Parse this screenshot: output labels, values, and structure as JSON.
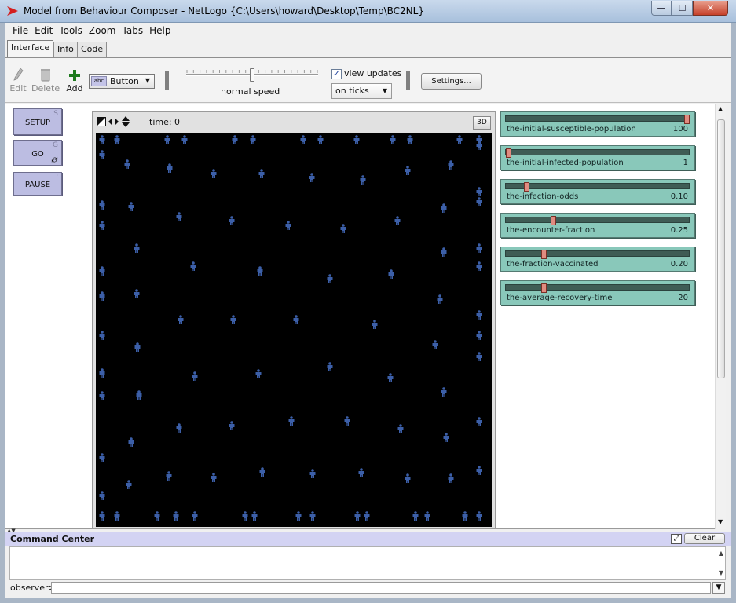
{
  "window": {
    "title": "Model from Behaviour Composer - NetLogo {C:\\Users\\howard\\Desktop\\Temp\\BC2NL}",
    "min_glyph": "—",
    "max_glyph": "☐",
    "close_glyph": "✕"
  },
  "menu": [
    "File",
    "Edit",
    "Tools",
    "Zoom",
    "Tabs",
    "Help"
  ],
  "tabs": [
    {
      "label": "Interface",
      "active": true
    },
    {
      "label": "Info",
      "active": false
    },
    {
      "label": "Code",
      "active": false
    }
  ],
  "toolbar": {
    "edit_label": "Edit",
    "delete_label": "Delete",
    "add_label": "Add",
    "widget_type_icon_text": "abc",
    "widget_type": "Button",
    "speed_label": "normal speed",
    "speed_fraction": 0.5,
    "view_updates_label": "view updates",
    "view_updates_checked": true,
    "update_mode": "on ticks",
    "settings_label": "Settings..."
  },
  "buttons": [
    {
      "label": "SETUP",
      "key": "S",
      "forever": false
    },
    {
      "label": "GO",
      "key": "G",
      "forever": true
    },
    {
      "label": "PAUSE",
      "key": "'",
      "forever": false
    }
  ],
  "view": {
    "tick_label": "time: 0",
    "three_d_label": "3D",
    "background": "#000000",
    "turtle_color": "#3c5fa8"
  },
  "sliders": [
    {
      "name": "the-initial-susceptible-population",
      "value": "100",
      "fraction": 1.0
    },
    {
      "name": "the-initial-infected-population",
      "value": "1",
      "fraction": 0.0
    },
    {
      "name": "the-infection-odds",
      "value": "0.10",
      "fraction": 0.1
    },
    {
      "name": "the-encounter-fraction",
      "value": "0.25",
      "fraction": 0.25
    },
    {
      "name": "the-fraction-vaccinated",
      "value": "0.20",
      "fraction": 0.2
    },
    {
      "name": "the-average-recovery-time",
      "value": "20",
      "fraction": 0.2
    }
  ],
  "command_center": {
    "title": "Command Center",
    "clear_label": "Clear",
    "prompt": "observer>",
    "input_value": ""
  },
  "colors": {
    "button_bg": "#bcbde2",
    "slider_bg": "#89c8ba",
    "command_header": "#d3d3f3"
  }
}
